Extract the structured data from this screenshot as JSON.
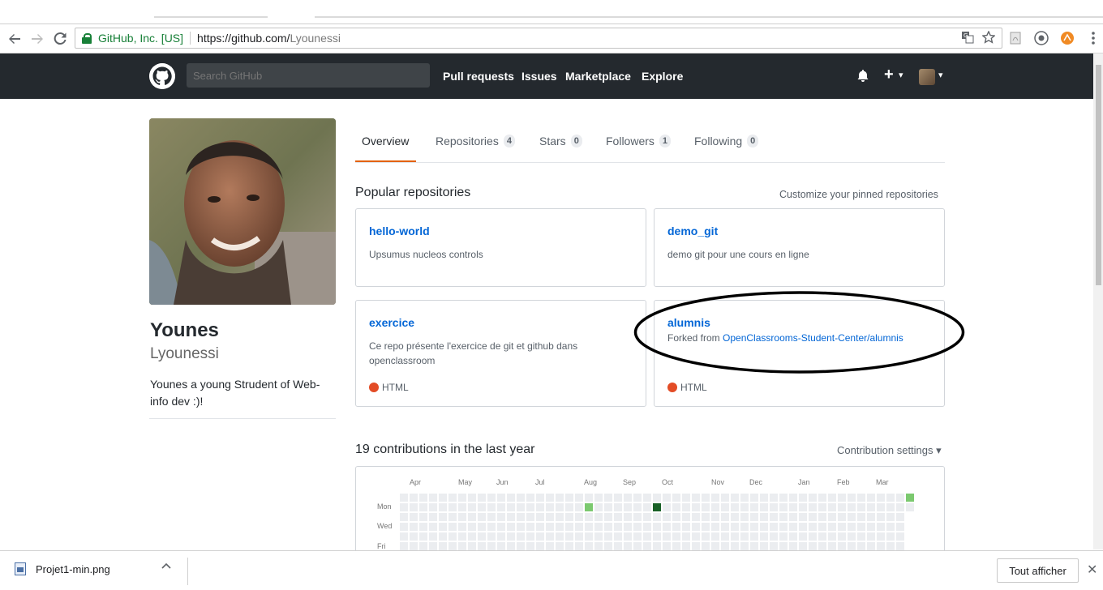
{
  "browser": {
    "secure_label": "GitHub, Inc. [US]",
    "url_host": "https://github.com/",
    "url_path": "Lyounessi"
  },
  "header": {
    "search_placeholder": "Search GitHub",
    "nav": [
      "Pull requests",
      "Issues",
      "Marketplace",
      "Explore"
    ],
    "plus_label": "+",
    "caret": "▾"
  },
  "profile": {
    "name": "Younes",
    "login": "Lyounessi",
    "bio": "Younes a young Strudent of Web-info dev :)!"
  },
  "tabs": [
    {
      "label": "Overview",
      "count": ""
    },
    {
      "label": "Repositories",
      "count": "4"
    },
    {
      "label": "Stars",
      "count": "0"
    },
    {
      "label": "Followers",
      "count": "1"
    },
    {
      "label": "Following",
      "count": "0"
    }
  ],
  "pinned": {
    "title": "Popular repositories",
    "customize": "Customize your pinned repositories",
    "repos": [
      {
        "name": "hello-world",
        "desc": "Upsumus nucleos controls",
        "lang": ""
      },
      {
        "name": "demo_git",
        "desc": "demo git pour une cours en ligne",
        "lang": ""
      },
      {
        "name": "exercice",
        "desc": "Ce repo présente l'exercice de git et github dans openclassroom",
        "lang": "HTML"
      },
      {
        "name": "alumnis",
        "forked_prefix": "Forked from",
        "forked_from": "OpenClassrooms-Student-Center/alumnis",
        "lang": "HTML"
      }
    ],
    "lang_color": "#e34c26"
  },
  "contributions": {
    "title": "19 contributions in the last year",
    "settings": "Contribution settings ▾",
    "months": [
      "Apr",
      "May",
      "Jun",
      "Jul",
      "Aug",
      "Sep",
      "Oct",
      "Nov",
      "Dec",
      "Jan",
      "Feb",
      "Mar"
    ],
    "days": [
      "Mon",
      "Wed",
      "Fri"
    ],
    "colors": {
      "empty": "#ebedf0",
      "l1": "#7bc96f",
      "l4": "#196127"
    }
  },
  "download": {
    "file": "Projet1-min.png",
    "show_all": "Tout afficher",
    "close": "✕",
    "chevron": "^"
  }
}
